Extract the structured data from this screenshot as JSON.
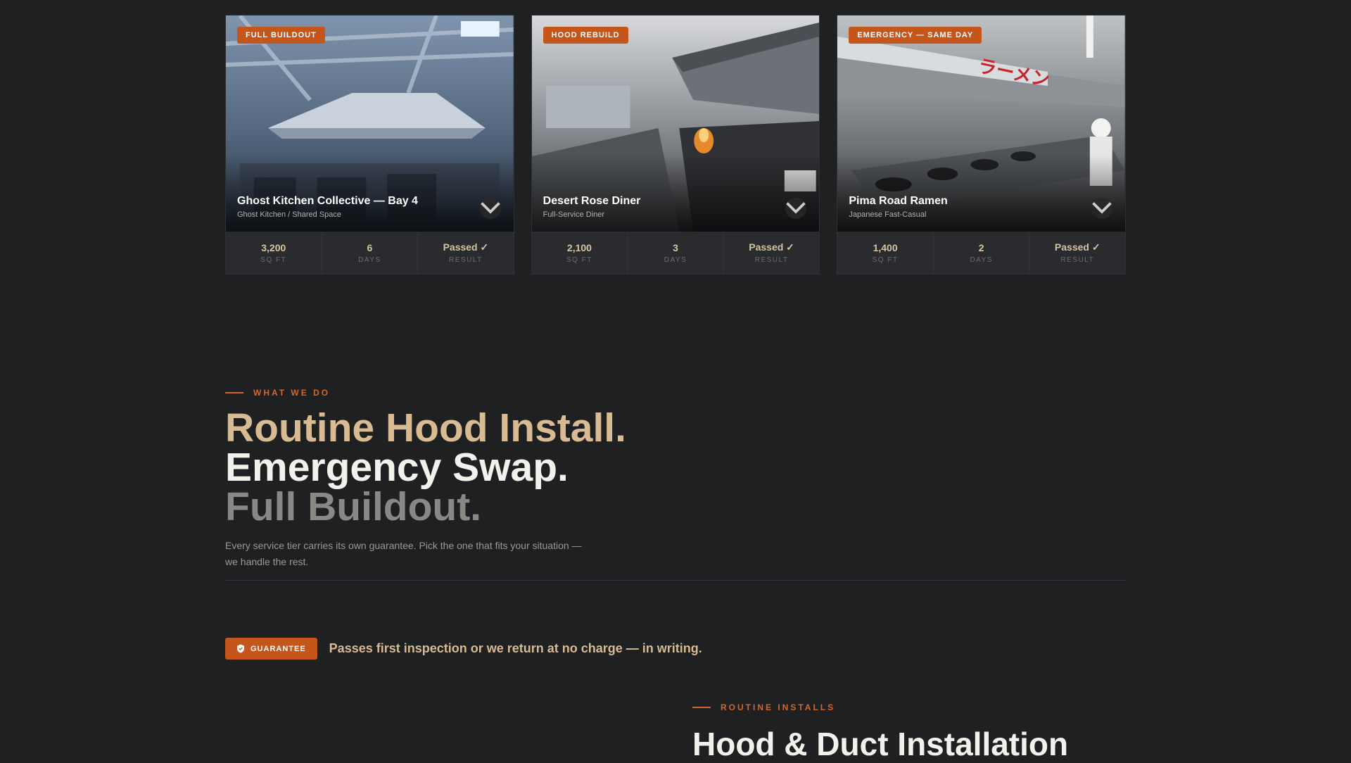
{
  "projects": [
    {
      "badge": "FULL BUILDOUT",
      "title": "Ghost Kitchen Collective — Bay 4",
      "subtitle": "Ghost Kitchen / Shared Space",
      "stats": [
        {
          "value": "3,200",
          "label": "SQ FT"
        },
        {
          "value": "6",
          "label": "DAYS"
        },
        {
          "value": "Passed ✓",
          "label": "RESULT"
        }
      ]
    },
    {
      "badge": "HOOD REBUILD",
      "title": "Desert Rose Diner",
      "subtitle": "Full-Service Diner",
      "stats": [
        {
          "value": "2,100",
          "label": "SQ FT"
        },
        {
          "value": "3",
          "label": "DAYS"
        },
        {
          "value": "Passed ✓",
          "label": "RESULT"
        }
      ]
    },
    {
      "badge": "EMERGENCY — SAME DAY",
      "title": "Pima Road Ramen",
      "subtitle": "Japanese Fast-Casual",
      "sign_text": "ラーメン",
      "stats": [
        {
          "value": "1,400",
          "label": "SQ FT"
        },
        {
          "value": "2",
          "label": "DAYS"
        },
        {
          "value": "Passed ✓",
          "label": "RESULT"
        }
      ]
    }
  ],
  "what_we_do": {
    "eyebrow": "WHAT WE DO",
    "line1": "Routine Hood Install.",
    "line2": "Emergency Swap.",
    "line3": "Full Buildout.",
    "lead": "Every service tier carries its own guarantee. Pick the one that fits your situation — we handle the rest."
  },
  "guarantee": {
    "badge": "GUARANTEE",
    "text": "Passes first inspection or we return at no charge — in writing."
  },
  "routine_installs": {
    "eyebrow": "ROUTINE INSTALLS",
    "title": "Hood & Duct Installation"
  },
  "colors": {
    "background": "#1f2022",
    "accent": "#c4551b",
    "tan": "#d8bb93",
    "card": "#2a2b2e"
  },
  "icons": [
    "chevron-down-icon",
    "shield-icon"
  ]
}
